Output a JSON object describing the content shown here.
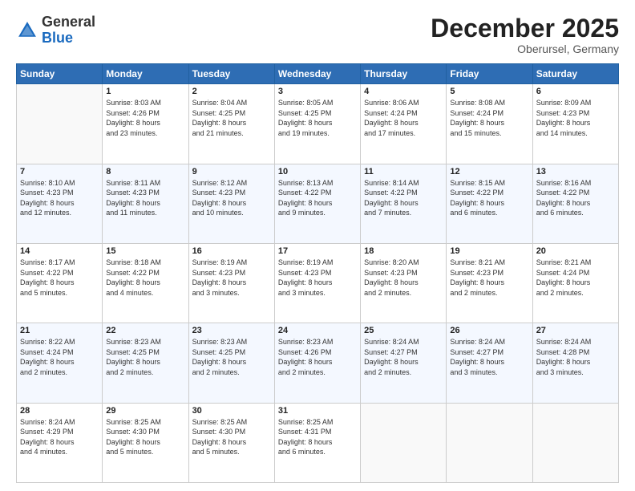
{
  "header": {
    "logo_general": "General",
    "logo_blue": "Blue",
    "month_title": "December 2025",
    "location": "Oberursel, Germany"
  },
  "calendar": {
    "days_of_week": [
      "Sunday",
      "Monday",
      "Tuesday",
      "Wednesday",
      "Thursday",
      "Friday",
      "Saturday"
    ],
    "weeks": [
      [
        {
          "day": "",
          "info": ""
        },
        {
          "day": "1",
          "info": "Sunrise: 8:03 AM\nSunset: 4:26 PM\nDaylight: 8 hours\nand 23 minutes."
        },
        {
          "day": "2",
          "info": "Sunrise: 8:04 AM\nSunset: 4:25 PM\nDaylight: 8 hours\nand 21 minutes."
        },
        {
          "day": "3",
          "info": "Sunrise: 8:05 AM\nSunset: 4:25 PM\nDaylight: 8 hours\nand 19 minutes."
        },
        {
          "day": "4",
          "info": "Sunrise: 8:06 AM\nSunset: 4:24 PM\nDaylight: 8 hours\nand 17 minutes."
        },
        {
          "day": "5",
          "info": "Sunrise: 8:08 AM\nSunset: 4:24 PM\nDaylight: 8 hours\nand 15 minutes."
        },
        {
          "day": "6",
          "info": "Sunrise: 8:09 AM\nSunset: 4:23 PM\nDaylight: 8 hours\nand 14 minutes."
        }
      ],
      [
        {
          "day": "7",
          "info": "Sunrise: 8:10 AM\nSunset: 4:23 PM\nDaylight: 8 hours\nand 12 minutes."
        },
        {
          "day": "8",
          "info": "Sunrise: 8:11 AM\nSunset: 4:23 PM\nDaylight: 8 hours\nand 11 minutes."
        },
        {
          "day": "9",
          "info": "Sunrise: 8:12 AM\nSunset: 4:23 PM\nDaylight: 8 hours\nand 10 minutes."
        },
        {
          "day": "10",
          "info": "Sunrise: 8:13 AM\nSunset: 4:22 PM\nDaylight: 8 hours\nand 9 minutes."
        },
        {
          "day": "11",
          "info": "Sunrise: 8:14 AM\nSunset: 4:22 PM\nDaylight: 8 hours\nand 7 minutes."
        },
        {
          "day": "12",
          "info": "Sunrise: 8:15 AM\nSunset: 4:22 PM\nDaylight: 8 hours\nand 6 minutes."
        },
        {
          "day": "13",
          "info": "Sunrise: 8:16 AM\nSunset: 4:22 PM\nDaylight: 8 hours\nand 6 minutes."
        }
      ],
      [
        {
          "day": "14",
          "info": "Sunrise: 8:17 AM\nSunset: 4:22 PM\nDaylight: 8 hours\nand 5 minutes."
        },
        {
          "day": "15",
          "info": "Sunrise: 8:18 AM\nSunset: 4:22 PM\nDaylight: 8 hours\nand 4 minutes."
        },
        {
          "day": "16",
          "info": "Sunrise: 8:19 AM\nSunset: 4:23 PM\nDaylight: 8 hours\nand 3 minutes."
        },
        {
          "day": "17",
          "info": "Sunrise: 8:19 AM\nSunset: 4:23 PM\nDaylight: 8 hours\nand 3 minutes."
        },
        {
          "day": "18",
          "info": "Sunrise: 8:20 AM\nSunset: 4:23 PM\nDaylight: 8 hours\nand 2 minutes."
        },
        {
          "day": "19",
          "info": "Sunrise: 8:21 AM\nSunset: 4:23 PM\nDaylight: 8 hours\nand 2 minutes."
        },
        {
          "day": "20",
          "info": "Sunrise: 8:21 AM\nSunset: 4:24 PM\nDaylight: 8 hours\nand 2 minutes."
        }
      ],
      [
        {
          "day": "21",
          "info": "Sunrise: 8:22 AM\nSunset: 4:24 PM\nDaylight: 8 hours\nand 2 minutes."
        },
        {
          "day": "22",
          "info": "Sunrise: 8:23 AM\nSunset: 4:25 PM\nDaylight: 8 hours\nand 2 minutes."
        },
        {
          "day": "23",
          "info": "Sunrise: 8:23 AM\nSunset: 4:25 PM\nDaylight: 8 hours\nand 2 minutes."
        },
        {
          "day": "24",
          "info": "Sunrise: 8:23 AM\nSunset: 4:26 PM\nDaylight: 8 hours\nand 2 minutes."
        },
        {
          "day": "25",
          "info": "Sunrise: 8:24 AM\nSunset: 4:27 PM\nDaylight: 8 hours\nand 2 minutes."
        },
        {
          "day": "26",
          "info": "Sunrise: 8:24 AM\nSunset: 4:27 PM\nDaylight: 8 hours\nand 3 minutes."
        },
        {
          "day": "27",
          "info": "Sunrise: 8:24 AM\nSunset: 4:28 PM\nDaylight: 8 hours\nand 3 minutes."
        }
      ],
      [
        {
          "day": "28",
          "info": "Sunrise: 8:24 AM\nSunset: 4:29 PM\nDaylight: 8 hours\nand 4 minutes."
        },
        {
          "day": "29",
          "info": "Sunrise: 8:25 AM\nSunset: 4:30 PM\nDaylight: 8 hours\nand 5 minutes."
        },
        {
          "day": "30",
          "info": "Sunrise: 8:25 AM\nSunset: 4:30 PM\nDaylight: 8 hours\nand 5 minutes."
        },
        {
          "day": "31",
          "info": "Sunrise: 8:25 AM\nSunset: 4:31 PM\nDaylight: 8 hours\nand 6 minutes."
        },
        {
          "day": "",
          "info": ""
        },
        {
          "day": "",
          "info": ""
        },
        {
          "day": "",
          "info": ""
        }
      ]
    ]
  }
}
